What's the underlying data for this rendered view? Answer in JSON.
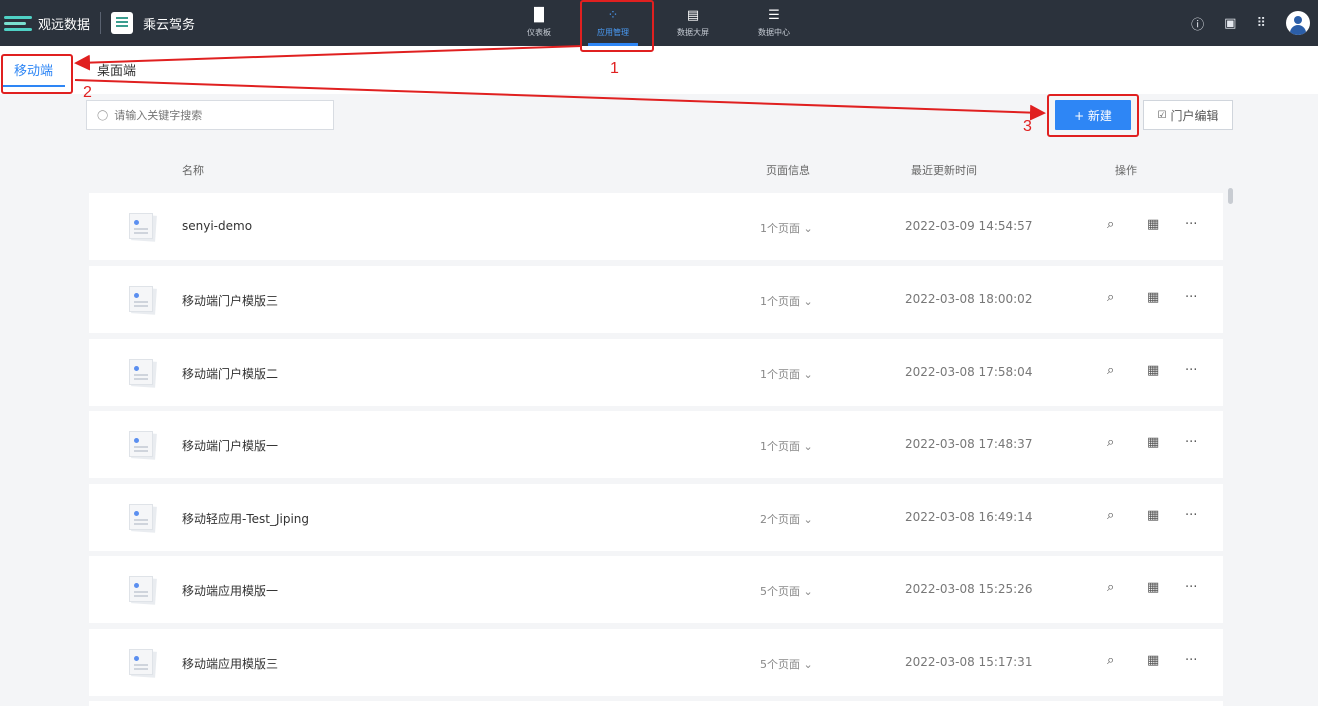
{
  "topbar": {
    "brand": "观远数据",
    "app_name": "乘云驾务",
    "nav": [
      {
        "label": "仪表板",
        "icon": "dashboard-icon",
        "active": false
      },
      {
        "label": "应用管理",
        "icon": "app-manage-icon",
        "active": true
      },
      {
        "label": "数据大屏",
        "icon": "big-screen-icon",
        "active": false
      },
      {
        "label": "数据中心",
        "icon": "data-center-icon",
        "active": false
      }
    ],
    "right_icons": [
      "help-icon",
      "message-icon",
      "apps-grid-icon",
      "avatar"
    ]
  },
  "tabs": [
    {
      "label": "移动端",
      "active": true
    },
    {
      "label": "桌面端",
      "active": false
    }
  ],
  "search": {
    "placeholder": "请输入关键字搜索"
  },
  "buttons": {
    "new_label": "+ 新建",
    "edit_label": "门户编辑"
  },
  "table": {
    "headers": {
      "name": "名称",
      "pages": "页面信息",
      "updated": "最近更新时间",
      "ops": "操作"
    },
    "rows": [
      {
        "name": "senyi-demo",
        "pages": "1个页面",
        "updated": "2022-03-09 14:54:57"
      },
      {
        "name": "移动端门户模版三",
        "pages": "1个页面",
        "updated": "2022-03-08 18:00:02"
      },
      {
        "name": "移动端门户模版二",
        "pages": "1个页面",
        "updated": "2022-03-08 17:58:04"
      },
      {
        "name": "移动端门户模版一",
        "pages": "1个页面",
        "updated": "2022-03-08 17:48:37"
      },
      {
        "name": "移动轻应用-Test_Jiping",
        "pages": "2个页面",
        "updated": "2022-03-08 16:49:14"
      },
      {
        "name": "移动端应用模版一",
        "pages": "5个页面",
        "updated": "2022-03-08 15:25:26"
      },
      {
        "name": "移动端应用模版三",
        "pages": "5个页面",
        "updated": "2022-03-08 15:17:31"
      }
    ]
  },
  "annotations": {
    "n1": "1",
    "n2": "2",
    "n3": "3",
    "color": "#e02020"
  },
  "colors": {
    "accent": "#2e86f5",
    "topbar": "#2b323c"
  }
}
